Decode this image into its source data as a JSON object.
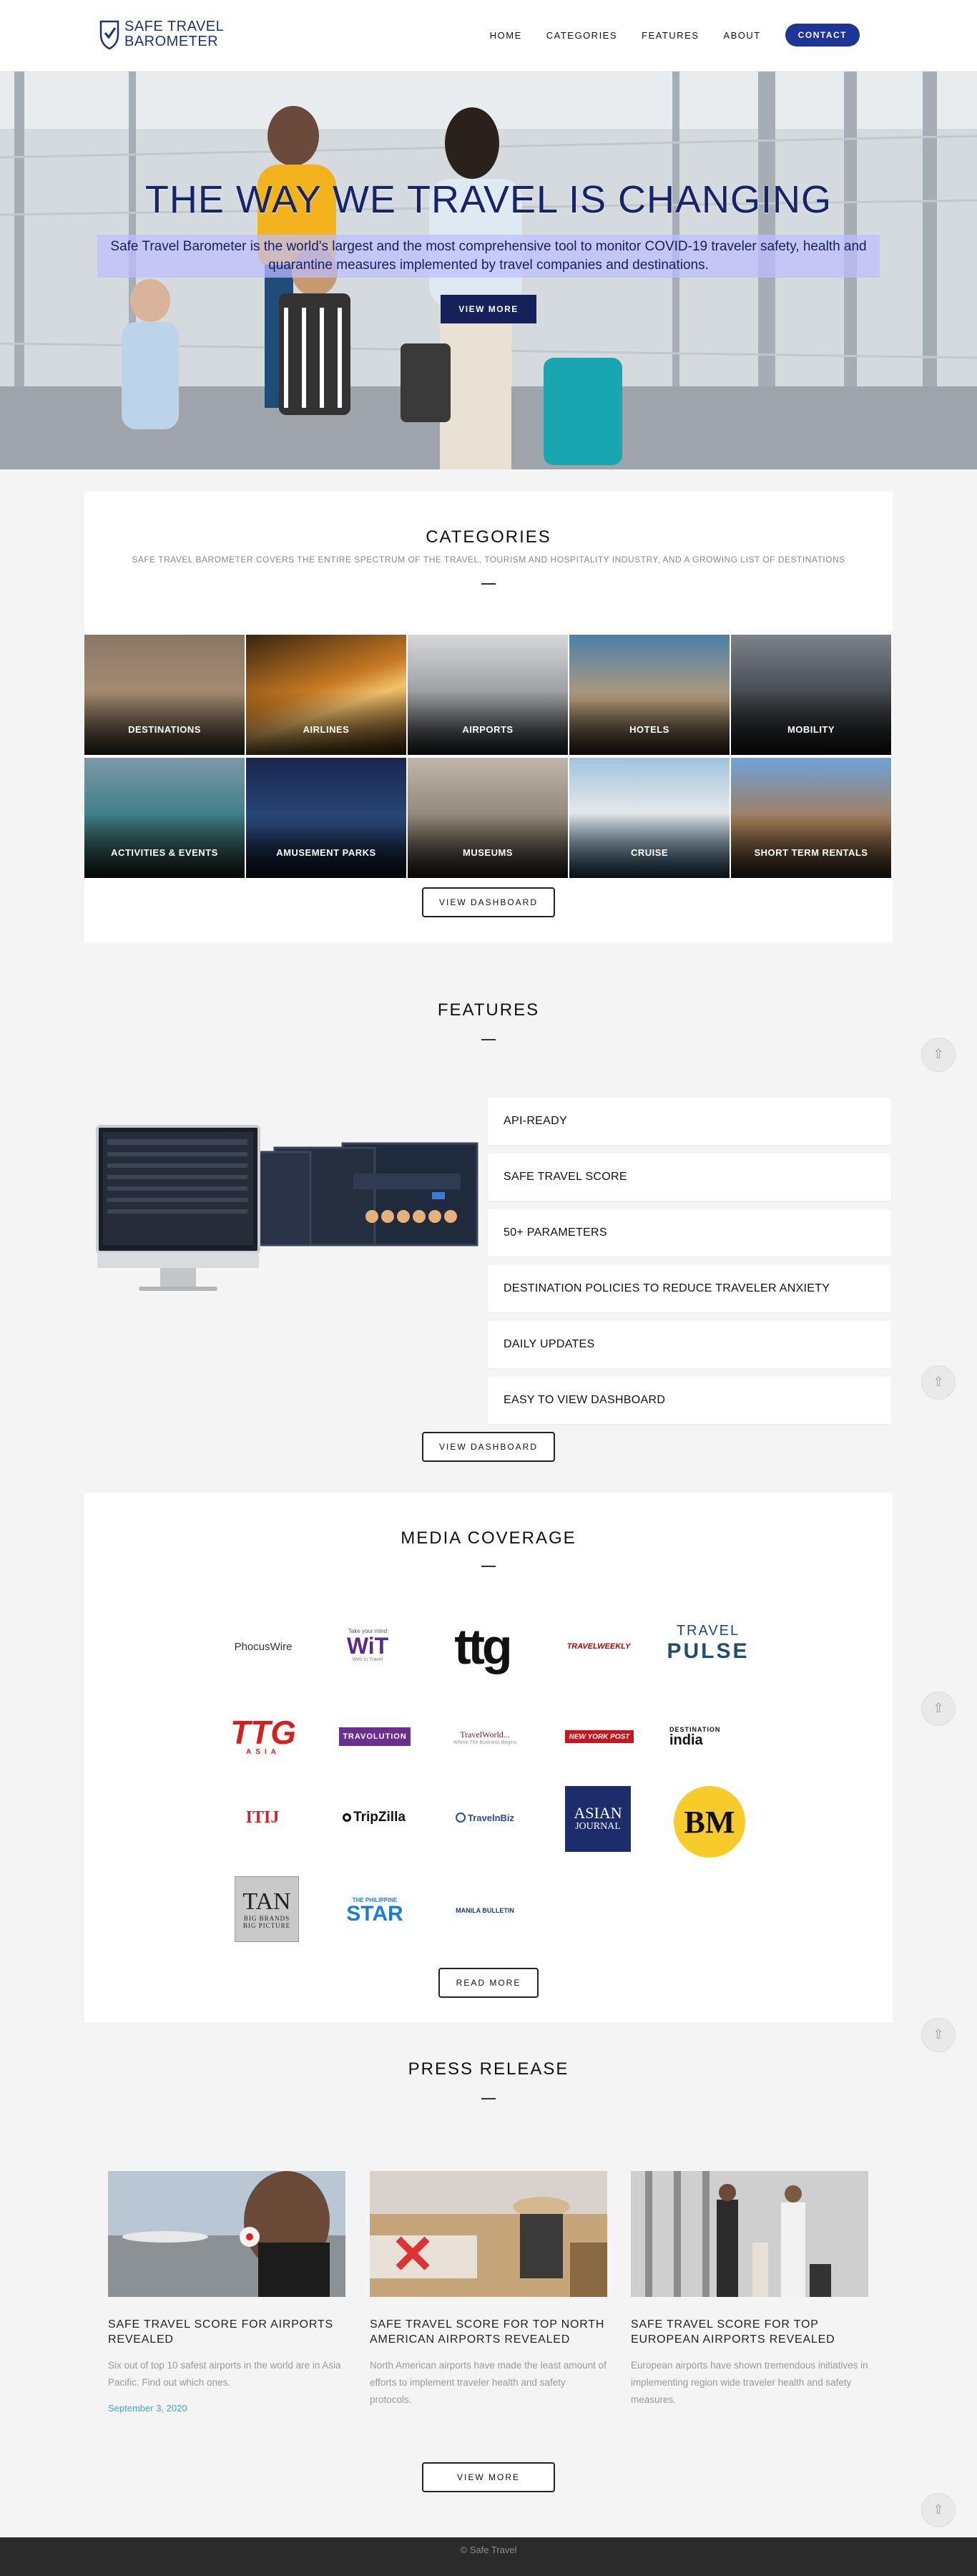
{
  "header": {
    "logo_line1": "SAFE TRAVEL",
    "logo_line2": "BAROMETER",
    "nav": [
      "HOME",
      "CATEGORIES",
      "FEATURES",
      "ABOUT"
    ],
    "contact": "CONTACT",
    "brand_color": "#1d3596"
  },
  "hero": {
    "title": "THE WAY WE TRAVEL IS CHANGING",
    "subtitle": "Safe Travel Barometer is the world's largest and the most comprehensive tool to monitor COVID-19 traveler safety, health and quarantine measures implemented by travel companies and destinations.",
    "button": "VIEW MORE"
  },
  "categories": {
    "title": "CATEGORIES",
    "subtitle": "SAFE TRAVEL BAROMETER COVERS THE ENTIRE SPECTRUM OF THE TRAVEL, TOURISM AND HOSPITALITY INDUSTRY, AND A GROWING LIST OF DESTINATIONS",
    "items": [
      "DESTINATIONS",
      "AIRLINES",
      "AIRPORTS",
      "HOTELS",
      "MOBILITY",
      "ACTIVITIES & EVENTS",
      "AMUSEMENT PARKS",
      "MUSEUMS",
      "CRUISE",
      "SHORT TERM RENTALS"
    ],
    "button": "VIEW DASHBOARD"
  },
  "features": {
    "title": "FEATURES",
    "items": [
      "API-READY",
      "SAFE TRAVEL SCORE",
      "50+ PARAMETERS",
      "DESTINATION POLICIES TO REDUCE TRAVELER ANXIETY",
      "DAILY UPDATES",
      "EASY TO VIEW DASHBOARD"
    ],
    "button": "VIEW DASHBOARD"
  },
  "media": {
    "title": "MEDIA COVERAGE",
    "logos": {
      "phocuswire": "PhocusWire",
      "wit_small": "Take your mind",
      "wit": "WiT",
      "wit_tag": "Web in Travel",
      "ttg": "ttg",
      "travelweekly": "TRAVELWEEKLY",
      "travelpulse_1": "TRAVEL",
      "travelpulse_2": "PULSE",
      "ttg_asia": "TTG",
      "ttg_asia_tag": "ASIA",
      "travolution": "TRAVOLUTION",
      "travelworld": "TravelWorld...",
      "travelworld_tag": "Where The Business Begins",
      "nypost": "NEW YORK POST",
      "destination": "DESTINATION",
      "india": "india",
      "itij": "ITIJ",
      "tripzilla": "TripZilla",
      "travelbiz": "TravelnBiz",
      "asian_1": "ASIAN",
      "asian_2": "JOURNAL",
      "bm": "BM",
      "tan": "TAN",
      "tan_tag_1": "BIG BRANDS",
      "tan_tag_2": "BIG PICTURE",
      "star_small": "THE PHILIPPINE",
      "star": "STAR",
      "manila": "MANILA BULLETIN"
    },
    "button": "READ MORE"
  },
  "press": {
    "title": "PRESS RELEASE",
    "items": [
      {
        "title": "SAFE TRAVEL SCORE FOR AIRPORTS REVEALED",
        "text": "Six out of top 10 safest airports in the world are in Asia Pacific. Find out which ones.",
        "date": "September 3, 2020"
      },
      {
        "title": "SAFE TRAVEL SCORE FOR TOP NORTH AMERICAN AIRPORTS REVEALED",
        "text": "North American airports have made the least amount of efforts to implement traveler health and safety protocols."
      },
      {
        "title": "SAFE TRAVEL SCORE FOR TOP EUROPEAN AIRPORTS REVEALED",
        "text": "European airports have shown tremendous initiatives in implementing region wide traveler health and safety measures."
      }
    ],
    "button": "VIEW MORE"
  },
  "footer": {
    "text": "© Safe Travel"
  }
}
